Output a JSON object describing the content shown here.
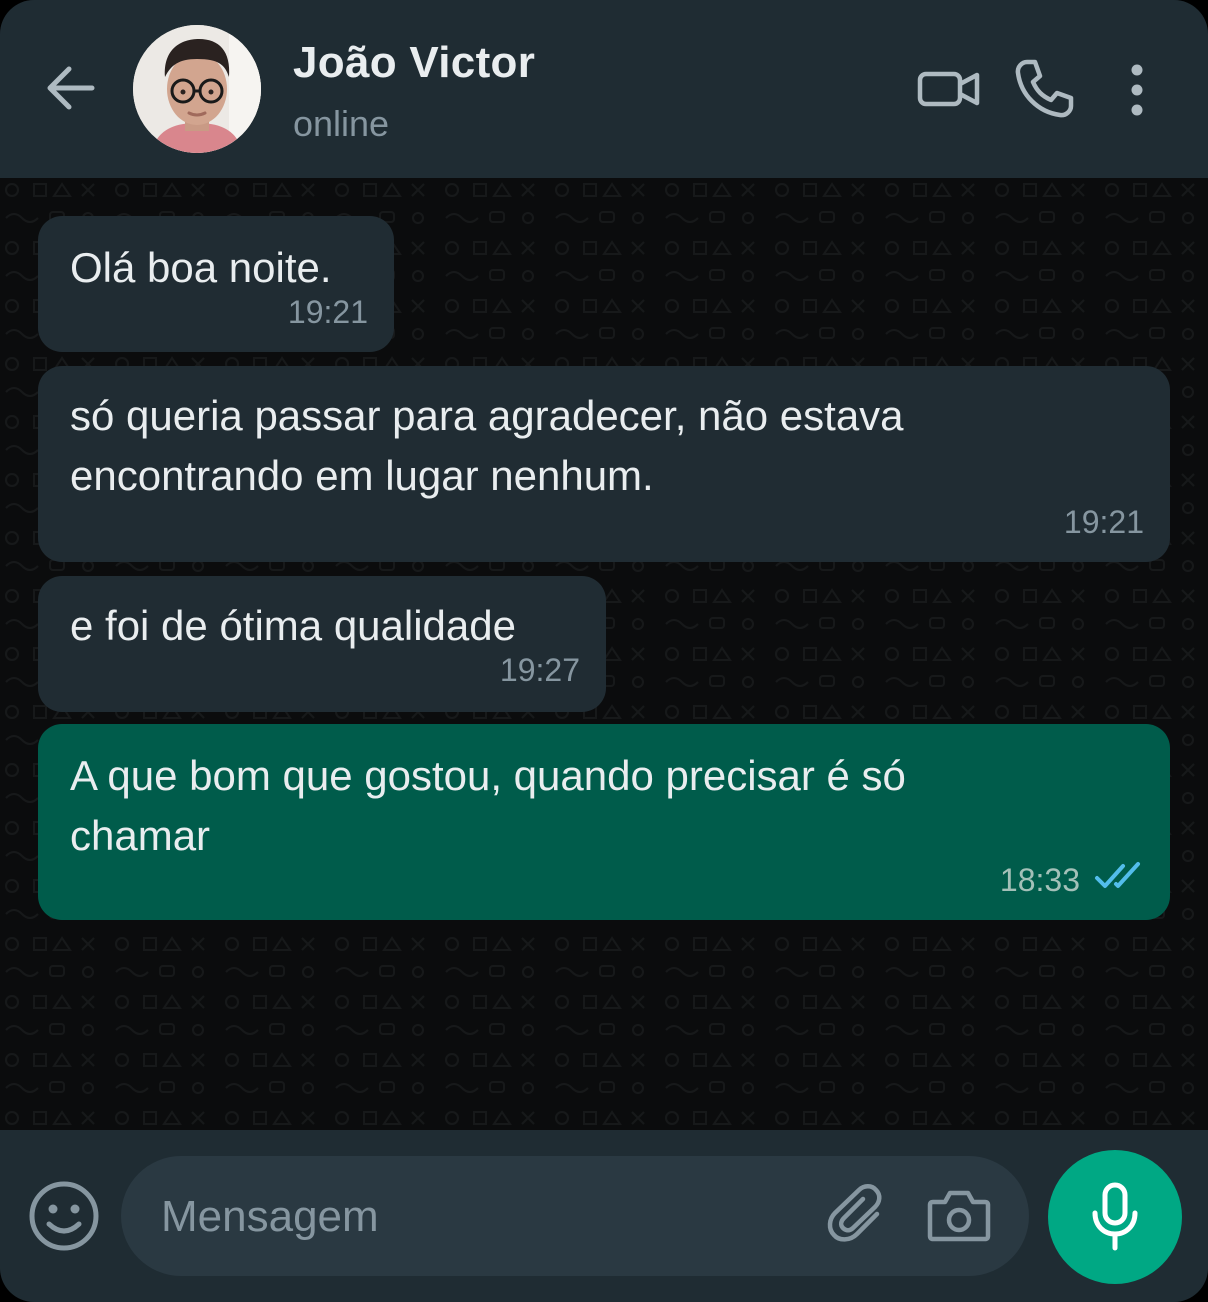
{
  "contact": {
    "name": "João Victor",
    "status": "online"
  },
  "header_icons": [
    "back-arrow-icon",
    "video-call-icon",
    "voice-call-icon",
    "more-options-icon"
  ],
  "messages": [
    {
      "direction": "incoming",
      "text_lines": [
        "Olá boa noite."
      ],
      "time": "19:21"
    },
    {
      "direction": "incoming",
      "text_lines": [
        "só queria passar para agradecer, não estava",
        "encontrando em lugar nenhum."
      ],
      "time": "19:21"
    },
    {
      "direction": "incoming",
      "text_lines": [
        "e foi de ótima qualidade"
      ],
      "time": "19:27"
    },
    {
      "direction": "outgoing",
      "text_lines": [
        "A que bom que gostou, quando precisar é só",
        "chamar"
      ],
      "time": "18:33",
      "read": true
    }
  ],
  "composer": {
    "placeholder": "Mensagem",
    "icons": [
      "emoji-icon",
      "attach-icon",
      "camera-icon",
      "microphone-icon"
    ]
  },
  "colors": {
    "header_bg": "#1f2c33",
    "chat_bg": "#0b0c0d",
    "incoming_bubble": "#202c33",
    "outgoing_bubble": "#005c4b",
    "accent": "#00a884",
    "read_ticks": "#53bdeb"
  }
}
